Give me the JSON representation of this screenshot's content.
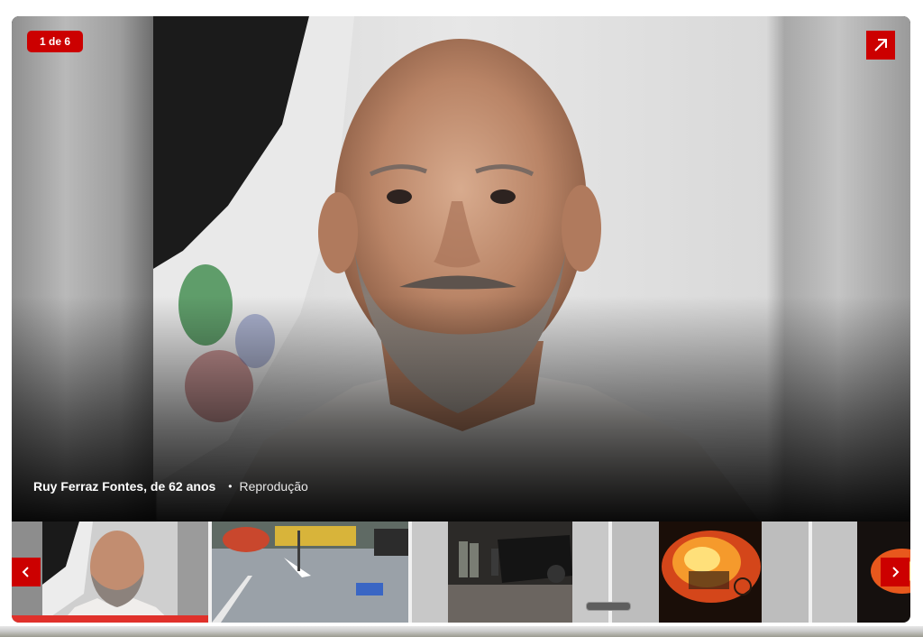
{
  "gallery": {
    "counter": "1 de 6",
    "caption": {
      "title": "Ruy Ferraz Fontes, de 62 anos",
      "separator": "•",
      "credit": "Reprodução"
    },
    "thumbnails": [
      {
        "label": "Ruy Ferraz Fontes portrait",
        "active": true
      },
      {
        "label": "Street scene with overturned vehicle",
        "active": false
      },
      {
        "label": "Police at overturned car at night",
        "active": false
      },
      {
        "label": "Burning car at night",
        "active": false
      },
      {
        "label": "Fire at night",
        "active": false
      }
    ]
  },
  "colors": {
    "accent": "#cc0000",
    "active_bar": "#e0312b"
  },
  "icons": {
    "expand": "arrow-up-right-icon",
    "prev": "chevron-left-icon",
    "next": "chevron-right-icon"
  }
}
